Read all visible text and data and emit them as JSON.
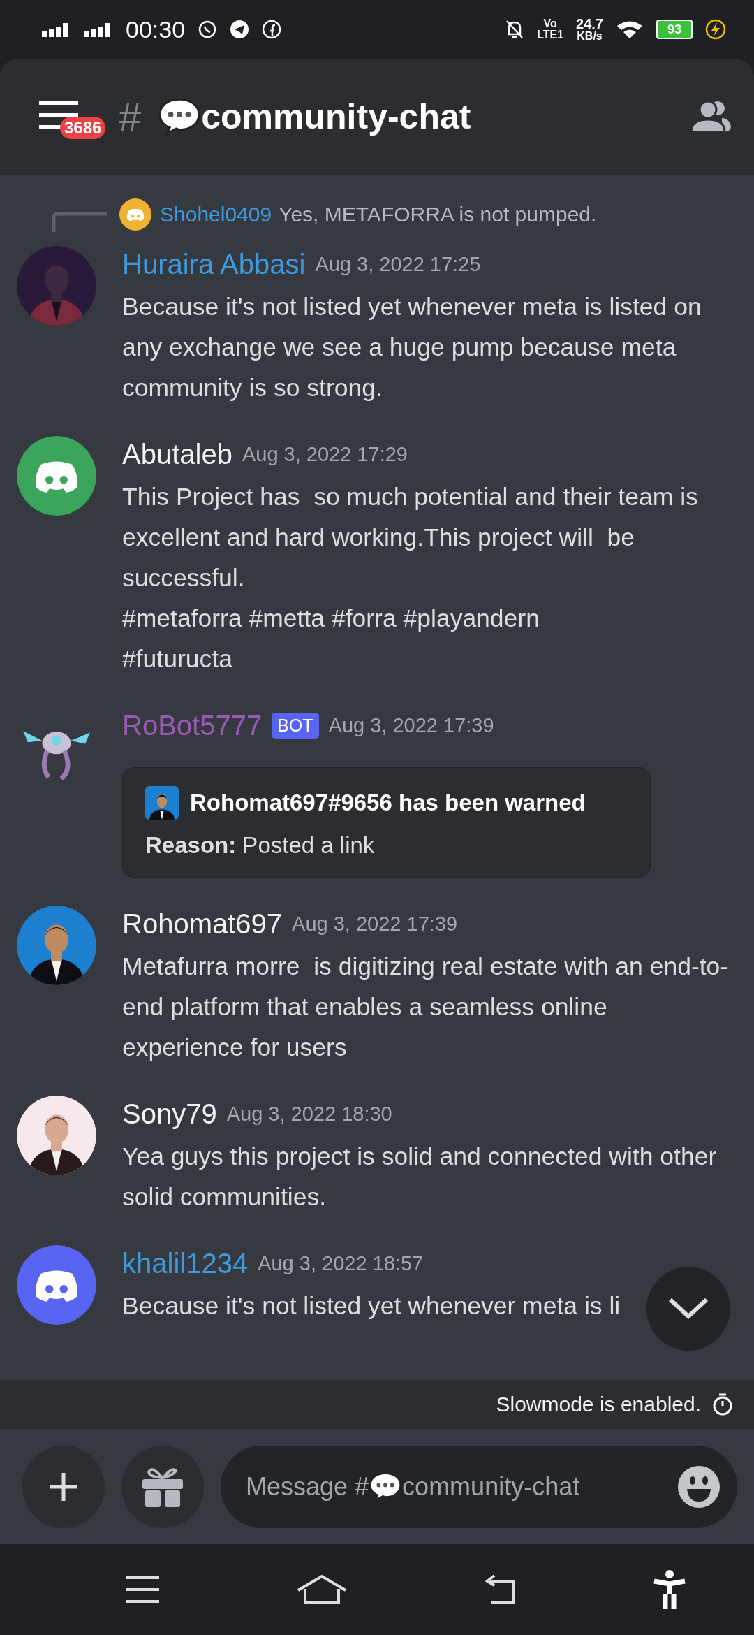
{
  "status_bar": {
    "time": "00:30",
    "volte": "Vo",
    "network": "LTE1",
    "speed": "24.7",
    "speed_unit": "KB/s",
    "battery": "93"
  },
  "header": {
    "badge": "3686",
    "hash": "#",
    "title": "community-chat"
  },
  "reply": {
    "author": "Shohel0409",
    "text": "Yes, METAFORRA is not pumped."
  },
  "messages": [
    {
      "author": "Huraira Abbasi",
      "color": "#3d9be0",
      "time": "Aug 3, 2022 17:25",
      "text": "Because it's not listed yet whenever meta is listed on any exchange we see a huge pump because meta community is so strong."
    },
    {
      "author": "Abutaleb",
      "color": "#f2f3f5",
      "avatar": {
        "kind": "discord",
        "color": "#3ba55c"
      },
      "time": "Aug 3, 2022 17:29",
      "text": "This Project has  so much potential and their team is excellent and hard working.This project will  be successful.\n#metaforra #metta #forra #playandern\n#futuructa"
    },
    {
      "author": "RoBot5777",
      "color": "#9b59b6",
      "badge": "BOT",
      "time": "Aug 3, 2022 17:39",
      "embed": {
        "title": "Rohomat697#9656 has been warned",
        "text": "**Reason:** Posted a link"
      }
    },
    {
      "author": "Rohomat697",
      "color": "#f2f3f5",
      "time": "Aug 3, 2022 17:39",
      "text": "Metafurra morre  is digitizing real estate with an end-to-end platform that enables a seamless online experience for users"
    },
    {
      "author": "Sony79",
      "color": "#f2f3f5",
      "time": "Aug 3, 2022 18:30",
      "text": "Yea guys this project is solid and connected with other solid communities."
    },
    {
      "author": "khalil1234",
      "color": "#3d9be0",
      "avatar": {
        "kind": "discord",
        "color": "#5865f2"
      },
      "time": "Aug 3, 2022 18:57",
      "text": "Because it's not listed yet whenever meta is li"
    }
  ],
  "slowmode": "Slowmode is enabled.",
  "composer": {
    "placeholder_start": "Message #",
    "placeholder_end": "community-chat"
  }
}
